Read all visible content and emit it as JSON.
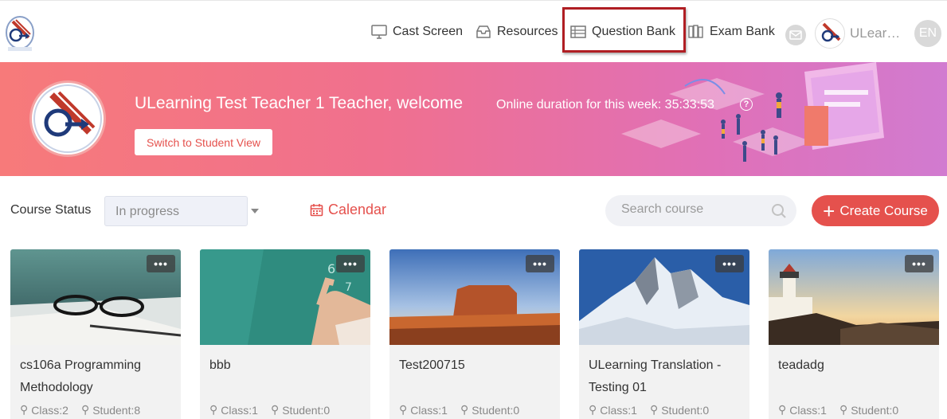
{
  "header": {
    "nav": [
      {
        "label": "Cast Screen",
        "icon": "monitor-icon"
      },
      {
        "label": "Resources",
        "icon": "inbox-icon"
      },
      {
        "label": "Question Bank",
        "icon": "question-bank-icon"
      },
      {
        "label": "Exam Bank",
        "icon": "exam-bank-icon"
      }
    ],
    "user_name": "ULear…",
    "language": "EN"
  },
  "banner": {
    "welcome": "ULearning Test Teacher 1 Teacher, welcome",
    "online_duration": "Online duration for this week: 35:33:53",
    "help": "?",
    "switch_label": "Switch to Student View"
  },
  "filters": {
    "status_label": "Course Status",
    "status_value": "In progress",
    "calendar_label": "Calendar",
    "search_placeholder": "Search course",
    "create_label": "Create Course"
  },
  "courses": [
    {
      "title": "cs106a Programming Methodology",
      "class": "Class:2",
      "student": "Student:8",
      "more": "•••"
    },
    {
      "title": "bbb",
      "class": "Class:1",
      "student": "Student:0",
      "more": "•••"
    },
    {
      "title": "Test200715",
      "class": "Class:1",
      "student": "Student:0",
      "more": "•••"
    },
    {
      "title": "ULearning Translation - Testing 01",
      "class": "Class:1",
      "student": "Student:0",
      "more": "•••"
    },
    {
      "title": "teadadg",
      "class": "Class:1",
      "student": "Student:0",
      "more": "•••"
    }
  ],
  "colors": {
    "accent": "#e5514d",
    "highlight_border": "#b01e23",
    "banner_start": "#f77a7a",
    "banner_end": "#d17bd0"
  }
}
